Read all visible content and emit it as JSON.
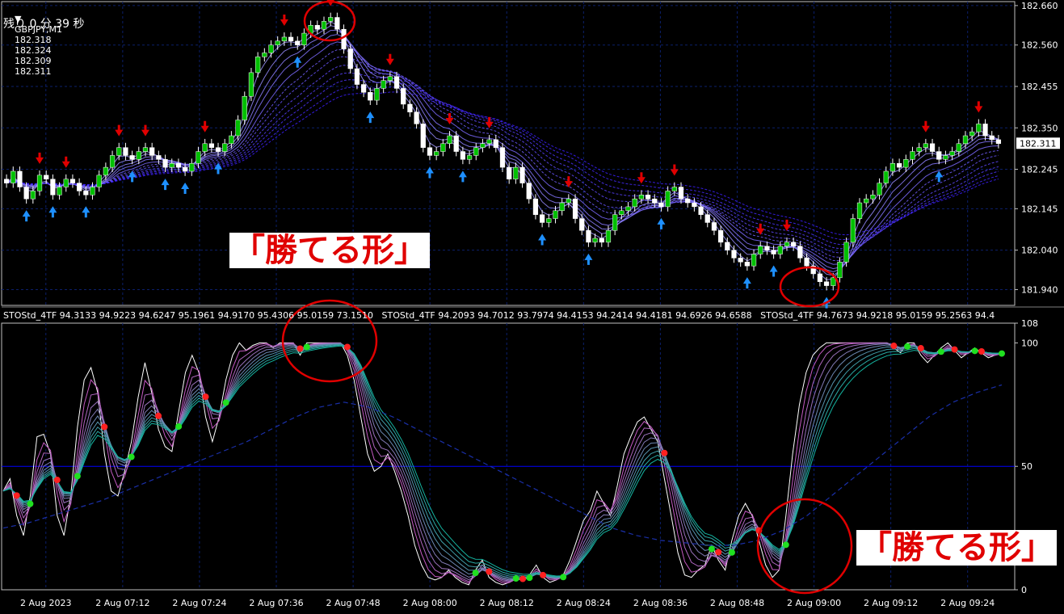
{
  "chart_data": [
    {
      "type": "candlestick",
      "title": "GBPJPY,M1",
      "ohlc_readout": [
        "182.318",
        "182.324",
        "182.309",
        "182.311"
      ],
      "countdown": "残り 0 分 39 秒",
      "y_ticks": [
        "182.660",
        "182.560",
        "182.455",
        "182.350",
        "182.245",
        "182.145",
        "182.040",
        "181.940"
      ],
      "ylim": [
        181.9,
        182.67
      ],
      "current_price": "182.311",
      "grid": true,
      "closes": [
        182.21,
        182.24,
        182.2,
        182.17,
        182.19,
        182.23,
        182.22,
        182.18,
        182.2,
        182.22,
        182.21,
        182.19,
        182.18,
        182.2,
        182.23,
        182.25,
        182.28,
        182.3,
        182.28,
        182.27,
        182.29,
        182.3,
        182.28,
        182.27,
        182.25,
        182.26,
        182.25,
        182.24,
        182.26,
        182.29,
        182.31,
        182.3,
        182.29,
        182.31,
        182.33,
        182.37,
        182.43,
        182.49,
        182.53,
        182.54,
        182.56,
        182.57,
        182.58,
        182.57,
        182.56,
        182.59,
        182.61,
        182.6,
        182.62,
        182.63,
        182.6,
        182.55,
        182.5,
        182.46,
        182.44,
        182.42,
        182.45,
        182.47,
        182.48,
        182.45,
        182.41,
        182.39,
        182.36,
        182.3,
        182.28,
        182.29,
        182.31,
        182.33,
        182.29,
        182.27,
        182.28,
        182.3,
        182.31,
        182.32,
        182.3,
        182.25,
        182.22,
        182.25,
        182.21,
        182.17,
        182.13,
        182.11,
        182.12,
        182.14,
        182.16,
        182.17,
        182.12,
        182.09,
        182.06,
        182.07,
        182.06,
        182.09,
        182.13,
        182.14,
        182.15,
        182.17,
        182.18,
        182.17,
        182.16,
        182.15,
        182.19,
        182.2,
        182.17,
        182.16,
        182.15,
        182.13,
        182.11,
        182.09,
        182.06,
        182.04,
        182.02,
        182.01,
        182.0,
        182.03,
        182.05,
        182.04,
        182.03,
        182.05,
        182.06,
        182.05,
        182.02,
        182.0,
        181.98,
        181.96,
        181.95,
        181.97,
        182.01,
        182.06,
        182.12,
        182.16,
        182.17,
        182.18,
        182.21,
        182.24,
        182.26,
        182.25,
        182.27,
        182.29,
        182.3,
        182.31,
        182.29,
        182.27,
        182.28,
        182.29,
        182.31,
        182.33,
        182.34,
        182.36,
        182.33,
        182.32,
        182.31
      ]
    },
    {
      "type": "line",
      "indicator_label": "STOStd_4TF 94.3133 94.9223 94.6247 95.1961 94.9170 95.4306 95.0159 73.1510   STOStd_4TF 94.2093 94.7012 93.7974 94.4153 94.2414 94.4181 94.6926 94.6588   STOStd_4TF 94.7673 94.9218 95.0159 95.2563 94.4",
      "ylim": [
        0,
        108
      ],
      "y_ticks": [
        "108",
        "100",
        "50",
        "0"
      ],
      "x_ticks": [
        "2 Aug 2023",
        "2 Aug 07:12",
        "2 Aug 07:24",
        "2 Aug 07:36",
        "2 Aug 07:48",
        "2 Aug 08:00",
        "2 Aug 08:12",
        "2 Aug 08:24",
        "2 Aug 08:36",
        "2 Aug 08:48",
        "2 Aug 09:00",
        "2 Aug 09:12",
        "2 Aug 09:24"
      ],
      "stochastic": [
        40,
        45,
        30,
        22,
        38,
        62,
        63,
        55,
        30,
        22,
        38,
        66,
        85,
        90,
        80,
        55,
        40,
        38,
        48,
        60,
        78,
        92,
        80,
        65,
        58,
        56,
        72,
        88,
        95,
        88,
        70,
        60,
        70,
        85,
        95,
        100,
        97,
        99,
        100,
        100,
        98,
        100,
        100,
        100,
        95,
        100,
        100,
        100,
        100,
        100,
        100,
        95,
        85,
        70,
        55,
        48,
        50,
        55,
        48,
        40,
        30,
        18,
        10,
        5,
        4,
        5,
        8,
        5,
        3,
        2,
        8,
        12,
        5,
        3,
        2,
        3,
        5,
        4,
        6,
        10,
        5,
        3,
        4,
        6,
        12,
        20,
        28,
        32,
        40,
        35,
        30,
        42,
        55,
        62,
        68,
        70,
        65,
        60,
        45,
        30,
        15,
        6,
        5,
        8,
        10,
        18,
        12,
        8,
        20,
        30,
        35,
        30,
        20,
        10,
        5,
        8,
        30,
        55,
        75,
        88,
        95,
        98,
        100,
        100,
        100,
        100,
        100,
        100,
        100,
        100,
        100,
        100,
        98,
        96,
        100,
        100,
        95,
        92,
        95,
        98,
        100,
        97,
        94,
        96,
        98,
        96,
        94,
        95,
        96
      ],
      "slow_line": [
        25,
        27,
        30,
        33,
        36,
        40,
        44,
        48,
        52,
        56,
        60,
        65,
        70,
        74,
        76,
        74,
        70,
        65,
        60,
        55,
        50,
        45,
        40,
        35,
        30,
        25,
        22,
        20,
        19,
        18,
        18,
        20,
        24,
        30,
        38,
        46,
        54,
        62,
        70,
        76,
        80,
        83
      ]
    }
  ],
  "callouts": [
    {
      "text": "「勝てる形」"
    },
    {
      "text": "「勝てる形」"
    }
  ],
  "markers": {
    "up_arrow_color": "#1e90ff",
    "down_arrow_color": "#e00000",
    "bull_candle": "#00c000",
    "bear_candle": "#ffffff",
    "circle_color": "#e00000"
  }
}
